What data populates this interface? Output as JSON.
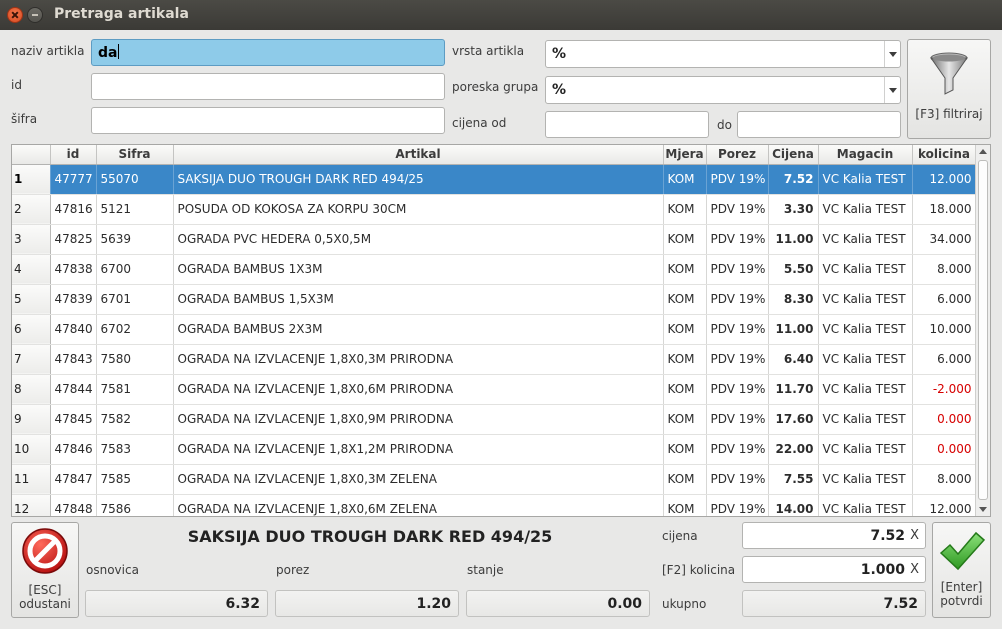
{
  "window": {
    "title": "Pretraga artikala"
  },
  "filters": {
    "naziv_label": "naziv artikla",
    "naziv_value": "da",
    "id_label": "id",
    "id_value": "",
    "sifra_label": "šifra",
    "sifra_value": "",
    "vrsta_label": "vrsta artikla",
    "vrsta_value": "%",
    "poreska_label": "poreska grupa",
    "poreska_value": "%",
    "cijena_od_label": "cijena od",
    "cijena_od_value": "",
    "do_label": "do",
    "do_value": "",
    "filter_button": "[F3] filtriraj"
  },
  "table": {
    "columns": [
      "",
      "id",
      "Sifra",
      "Artikal",
      "Mjera",
      "Porez",
      "Cijena",
      "Magacin",
      "kolicina"
    ],
    "rows": [
      {
        "n": "1",
        "id": "47777",
        "sifra": "55070",
        "artikal": "SAKSIJA DUO TROUGH DARK RED 494/25",
        "mjera": "KOM",
        "porez": "PDV 19%",
        "cijena": "7.52",
        "magacin": "VC Kalia TEST",
        "kolicina": "12.000",
        "neg": false,
        "selected": true
      },
      {
        "n": "2",
        "id": "47816",
        "sifra": "5121",
        "artikal": "POSUDA OD KOKOSA ZA KORPU 30CM",
        "mjera": "KOM",
        "porez": "PDV 19%",
        "cijena": "3.30",
        "magacin": "VC Kalia TEST",
        "kolicina": "18.000",
        "neg": false
      },
      {
        "n": "3",
        "id": "47825",
        "sifra": "5639",
        "artikal": "OGRADA PVC HEDERA 0,5X0,5M",
        "mjera": "KOM",
        "porez": "PDV 19%",
        "cijena": "11.00",
        "magacin": "VC Kalia TEST",
        "kolicina": "34.000",
        "neg": false
      },
      {
        "n": "4",
        "id": "47838",
        "sifra": "6700",
        "artikal": "OGRADA BAMBUS 1X3M",
        "mjera": "KOM",
        "porez": "PDV 19%",
        "cijena": "5.50",
        "magacin": "VC Kalia TEST",
        "kolicina": "8.000",
        "neg": false
      },
      {
        "n": "5",
        "id": "47839",
        "sifra": "6701",
        "artikal": "OGRADA BAMBUS 1,5X3M",
        "mjera": "KOM",
        "porez": "PDV 19%",
        "cijena": "8.30",
        "magacin": "VC Kalia TEST",
        "kolicina": "6.000",
        "neg": false
      },
      {
        "n": "6",
        "id": "47840",
        "sifra": "6702",
        "artikal": "OGRADA BAMBUS 2X3M",
        "mjera": "KOM",
        "porez": "PDV 19%",
        "cijena": "11.00",
        "magacin": "VC Kalia TEST",
        "kolicina": "10.000",
        "neg": false
      },
      {
        "n": "7",
        "id": "47843",
        "sifra": "7580",
        "artikal": "OGRADA NA IZVLACENJE 1,8X0,3M PRIRODNA",
        "mjera": "KOM",
        "porez": "PDV 19%",
        "cijena": "6.40",
        "magacin": "VC Kalia TEST",
        "kolicina": "6.000",
        "neg": false
      },
      {
        "n": "8",
        "id": "47844",
        "sifra": "7581",
        "artikal": "OGRADA NA IZVLACENJE 1,8X0,6M PRIRODNA",
        "mjera": "KOM",
        "porez": "PDV 19%",
        "cijena": "11.70",
        "magacin": "VC Kalia TEST",
        "kolicina": "-2.000",
        "neg": true
      },
      {
        "n": "9",
        "id": "47845",
        "sifra": "7582",
        "artikal": "OGRADA NA IZVLACENJE 1,8X0,9M PRIRODNA",
        "mjera": "KOM",
        "porez": "PDV 19%",
        "cijena": "17.60",
        "magacin": "VC Kalia TEST",
        "kolicina": "0.000",
        "neg": true
      },
      {
        "n": "10",
        "id": "47846",
        "sifra": "7583",
        "artikal": "OGRADA NA IZVLACENJE 1,8X1,2M PRIRODNA",
        "mjera": "KOM",
        "porez": "PDV 19%",
        "cijena": "22.00",
        "magacin": "VC Kalia TEST",
        "kolicina": "0.000",
        "neg": true
      },
      {
        "n": "11",
        "id": "47847",
        "sifra": "7585",
        "artikal": "OGRADA NA IZVLACENJE 1,8X0,3M ZELENA",
        "mjera": "KOM",
        "porez": "PDV 19%",
        "cijena": "7.55",
        "magacin": "VC Kalia TEST",
        "kolicina": "8.000",
        "neg": false
      },
      {
        "n": "12",
        "id": "47848",
        "sifra": "7586",
        "artikal": "OGRADA NA IZVLACENJE 1,8X0,6M ZELENA",
        "mjera": "KOM",
        "porez": "PDV 19%",
        "cijena": "14.00",
        "magacin": "VC Kalia TEST",
        "kolicina": "12.000",
        "neg": false
      }
    ]
  },
  "bottom": {
    "esc_button_line1": "[ESC]",
    "esc_button_line2": "odustani",
    "selected_name": "SAKSIJA DUO TROUGH DARK RED 494/25",
    "osnovica_label": "osnovica",
    "osnovica_value": "6.32",
    "porez_label": "porez",
    "porez_value": "1.20",
    "stanje_label": "stanje",
    "stanje_value": "0.00",
    "cijena_label": "cijena",
    "cijena_value": "7.52",
    "kolicina_label": "[F2] kolicina",
    "kolicina_value": "1.000",
    "ukupno_label": "ukupno",
    "ukupno_value": "7.52",
    "clear_glyph": "X",
    "enter_button_line1": "[Enter]",
    "enter_button_line2": "potvrdi"
  },
  "colors": {
    "selection": "#3a87c8",
    "negative": "#d60000",
    "active_input": "#8ecbe9"
  },
  "icons": {
    "filter": "funnel-icon",
    "cancel": "no-entry-icon",
    "confirm": "check-icon"
  }
}
